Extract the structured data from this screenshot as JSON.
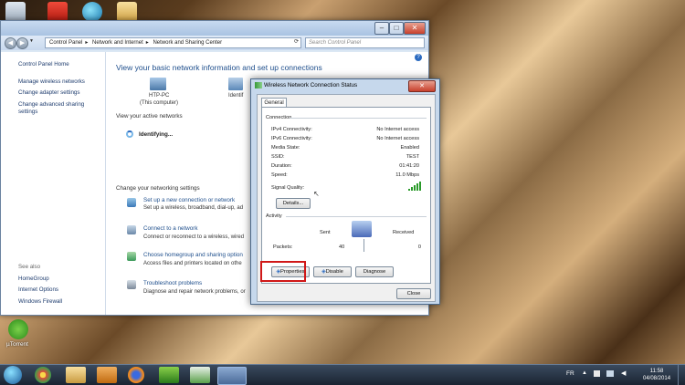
{
  "desktop": {
    "utorrent_label": "µTorrent"
  },
  "explorer": {
    "address_parts": [
      "Control Panel",
      "Network and Internet",
      "Network and Sharing Center"
    ],
    "search_placeholder": "Search Control Panel",
    "left_nav": {
      "home": "Control Panel Home",
      "items": [
        "Manage wireless networks",
        "Change adapter settings",
        "Change advanced sharing settings"
      ],
      "see_also_title": "See also",
      "see_also": [
        "HomeGroup",
        "Internet Options",
        "Windows Firewall"
      ]
    },
    "main": {
      "title": "View your basic network information and set up connections",
      "computer_name": "HTP-PC",
      "computer_sub": "(This computer)",
      "identify_label": "Identif",
      "active_networks_header": "View your active networks",
      "identifying": "Identifying...",
      "change_settings_header": "Change your networking settings",
      "tasks": [
        {
          "link": "Set up a new connection or network",
          "desc": "Set up a wireless, broadband, dial-up, ad"
        },
        {
          "link": "Connect to a network",
          "desc": "Connect or reconnect to a wireless, wired"
        },
        {
          "link": "Choose homegroup and sharing option",
          "desc": "Access files and printers located on othe"
        },
        {
          "link": "Troubleshoot problems",
          "desc": "Diagnose and repair network problems, or"
        }
      ]
    }
  },
  "dialog": {
    "title": "Wireless Network Connection Status",
    "tab": "General",
    "connection_header": "Connection",
    "rows": [
      {
        "label": "IPv4 Connectivity:",
        "value": "No Internet access"
      },
      {
        "label": "IPv6 Connectivity:",
        "value": "No Internet access"
      },
      {
        "label": "Media State:",
        "value": "Enabled"
      },
      {
        "label": "SSID:",
        "value": "TEST"
      },
      {
        "label": "Duration:",
        "value": "01:41:20"
      },
      {
        "label": "Speed:",
        "value": "11.0 Mbps"
      }
    ],
    "signal_label": "Signal Quality:",
    "details_button": "Details...",
    "activity_header": "Activity",
    "sent_label": "Sent",
    "received_label": "Received",
    "packets_label": "Packets:",
    "packets_sent": "40",
    "packets_received": "0",
    "properties_button": "Properties",
    "disable_button": "Disable",
    "diagnose_button": "Diagnose",
    "close_button": "Close"
  },
  "taskbar": {
    "language": "FR",
    "time": "11:58",
    "date": "04/08/2014"
  },
  "colors": {
    "highlight_box": "#d01818",
    "link": "#1e4e8c"
  }
}
